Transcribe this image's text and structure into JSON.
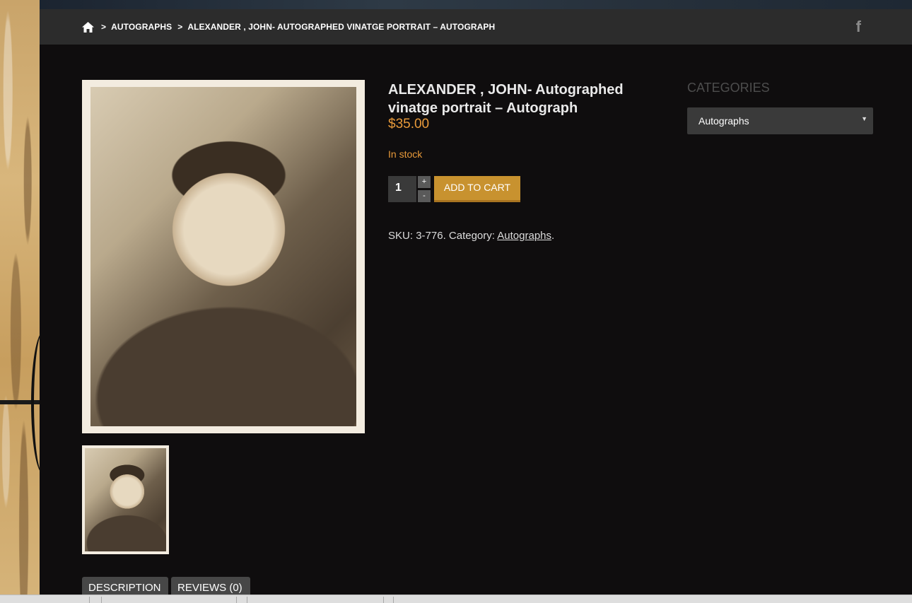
{
  "breadcrumb": {
    "home_icon": "home-icon",
    "separator": ">",
    "items": [
      "AUTOGRAPHS",
      "ALEXANDER , JOHN- AUTOGRAPHED VINATGE PORTRAIT – AUTOGRAPH"
    ]
  },
  "social": {
    "facebook_glyph": "f",
    "icon": "facebook-icon"
  },
  "product": {
    "title": "ALEXANDER , JOHN- Autographed vinatge portrait – Autograph",
    "price": "$35.00",
    "stock": "In stock",
    "quantity": "1",
    "qty_plus": "+",
    "qty_minus": "-",
    "add_to_cart": "ADD TO CART",
    "sku_label": "SKU:",
    "sku": "3-776",
    "category_label": "Category:",
    "category": "Autographs"
  },
  "sidebar": {
    "categories_title": "CATEGORIES",
    "selected_category": "Autographs",
    "caret": "▼"
  },
  "tabs": [
    "DESCRIPTION",
    "REVIEWS (0)"
  ],
  "colors": {
    "accent_orange": "#e89a3a",
    "button_gold": "#c8922f",
    "background": "#0f0d0e",
    "bar": "#2c2c2c"
  }
}
